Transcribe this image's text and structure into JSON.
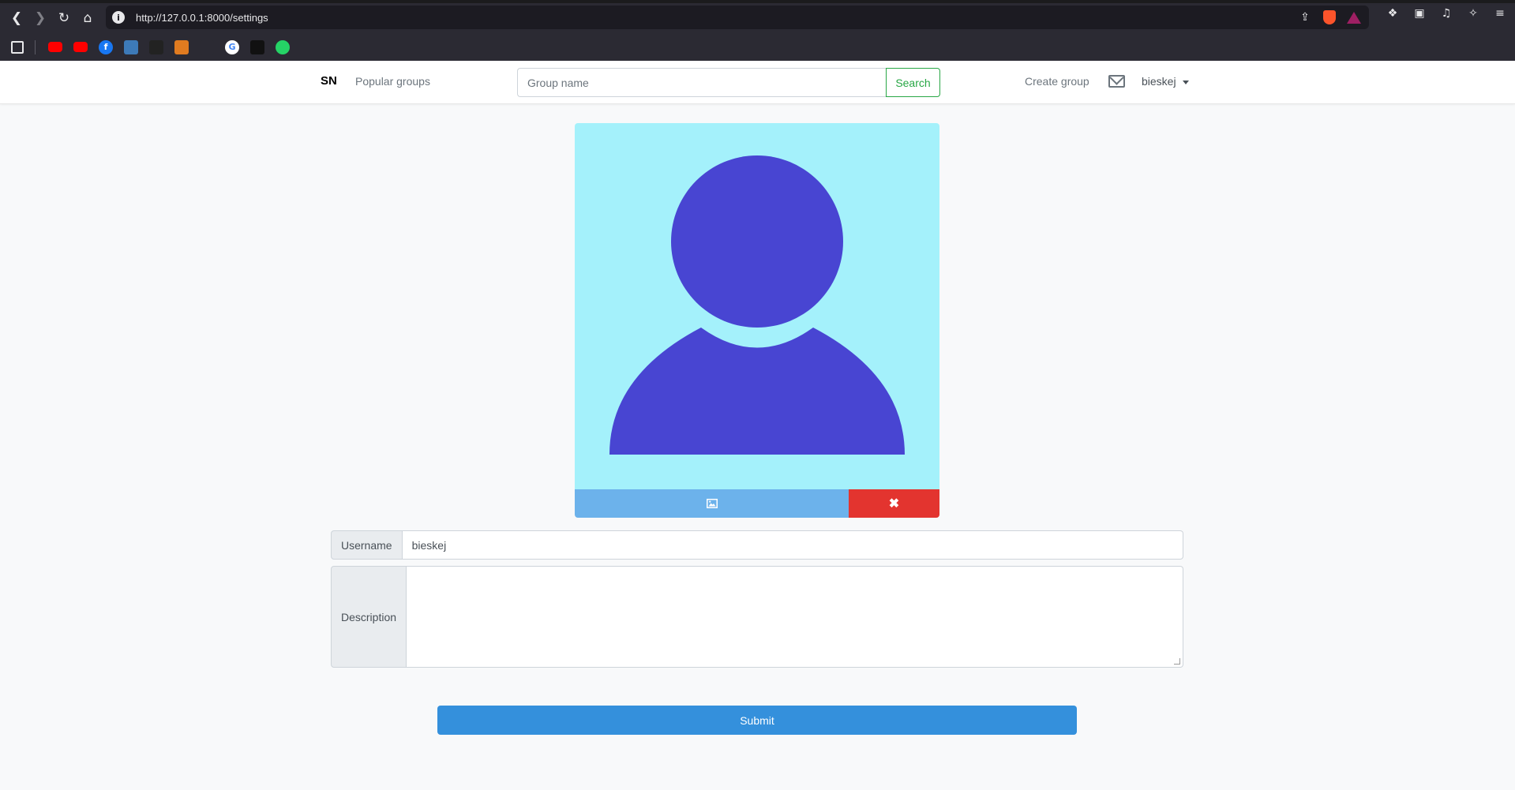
{
  "browser": {
    "url": "http://127.0.0.1:8000/settings",
    "info_icon": "info-icon",
    "bookmarks": [
      {
        "name": "youtube-icon",
        "color": "#ff0000"
      },
      {
        "name": "youtube-icon",
        "color": "#ff0000"
      },
      {
        "name": "facebook-icon",
        "color": "#1877f2"
      },
      {
        "name": "bookmark-icon",
        "color": "#3d7ab8"
      },
      {
        "name": "bookmark-icon",
        "color": "#222222"
      },
      {
        "name": "bookmark-icon",
        "color": "#e07b20"
      },
      {
        "name": "bookmark-icon",
        "color": "#2b2a33"
      },
      {
        "name": "google-icon",
        "color": "#ffffff"
      },
      {
        "name": "bookmark-icon",
        "color": "#111111"
      },
      {
        "name": "whatsapp-icon",
        "color": "#25d366"
      }
    ]
  },
  "navbar": {
    "brand": "SN",
    "popular_groups": "Popular groups",
    "search_placeholder": "Group name",
    "search_button": "Search",
    "create_group": "Create group",
    "username": "bieskej"
  },
  "avatar": {
    "background_color": "#a4f1fb",
    "figure_color": "#4845d2",
    "upload_icon": "image-icon",
    "remove_icon": "close-icon",
    "remove_glyph": "✖"
  },
  "form": {
    "username_label": "Username",
    "username_value": "bieskej",
    "description_label": "Description",
    "description_value": "",
    "submit_label": "Submit"
  }
}
